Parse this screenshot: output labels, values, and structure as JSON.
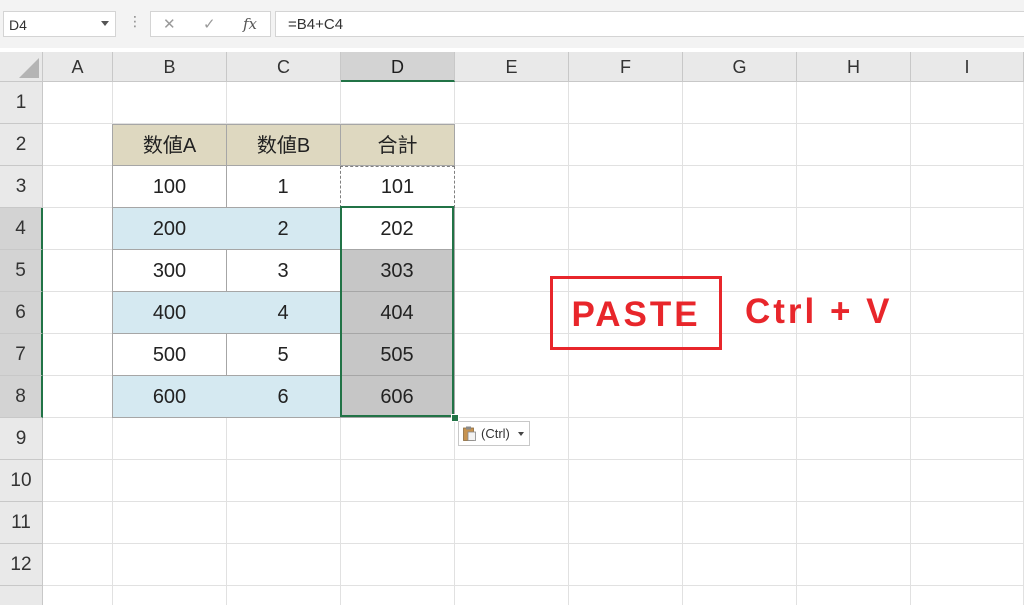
{
  "formula_bar": {
    "name_box": "D4",
    "dots": "⋮",
    "cancel_icon": "✕",
    "enter_icon": "✓",
    "fx_label": "fx",
    "formula": "=B4+C4"
  },
  "columns": [
    "A",
    "B",
    "C",
    "D",
    "E",
    "F",
    "G",
    "H",
    "I"
  ],
  "rows": [
    "1",
    "2",
    "3",
    "4",
    "5",
    "6",
    "7",
    "8",
    "9",
    "10",
    "11",
    "12"
  ],
  "table": {
    "headers": [
      "数値A",
      "数値B",
      "合計"
    ],
    "rows": [
      [
        "100",
        "1",
        "101"
      ],
      [
        "200",
        "2",
        "202"
      ],
      [
        "300",
        "3",
        "303"
      ],
      [
        "400",
        "4",
        "404"
      ],
      [
        "500",
        "5",
        "505"
      ],
      [
        "600",
        "6",
        "606"
      ]
    ]
  },
  "paste_options": {
    "label": "(Ctrl)",
    "icon": "clipboard-icon"
  },
  "annotation": {
    "box_text": "PASTE",
    "shortcut": "Ctrl + V",
    "color": "#e8262b"
  },
  "colors": {
    "header_fill": "#ded8c0",
    "band_fill": "#d5e9f1",
    "pasted_fill": "#c6c6c6",
    "selection": "#217346"
  }
}
